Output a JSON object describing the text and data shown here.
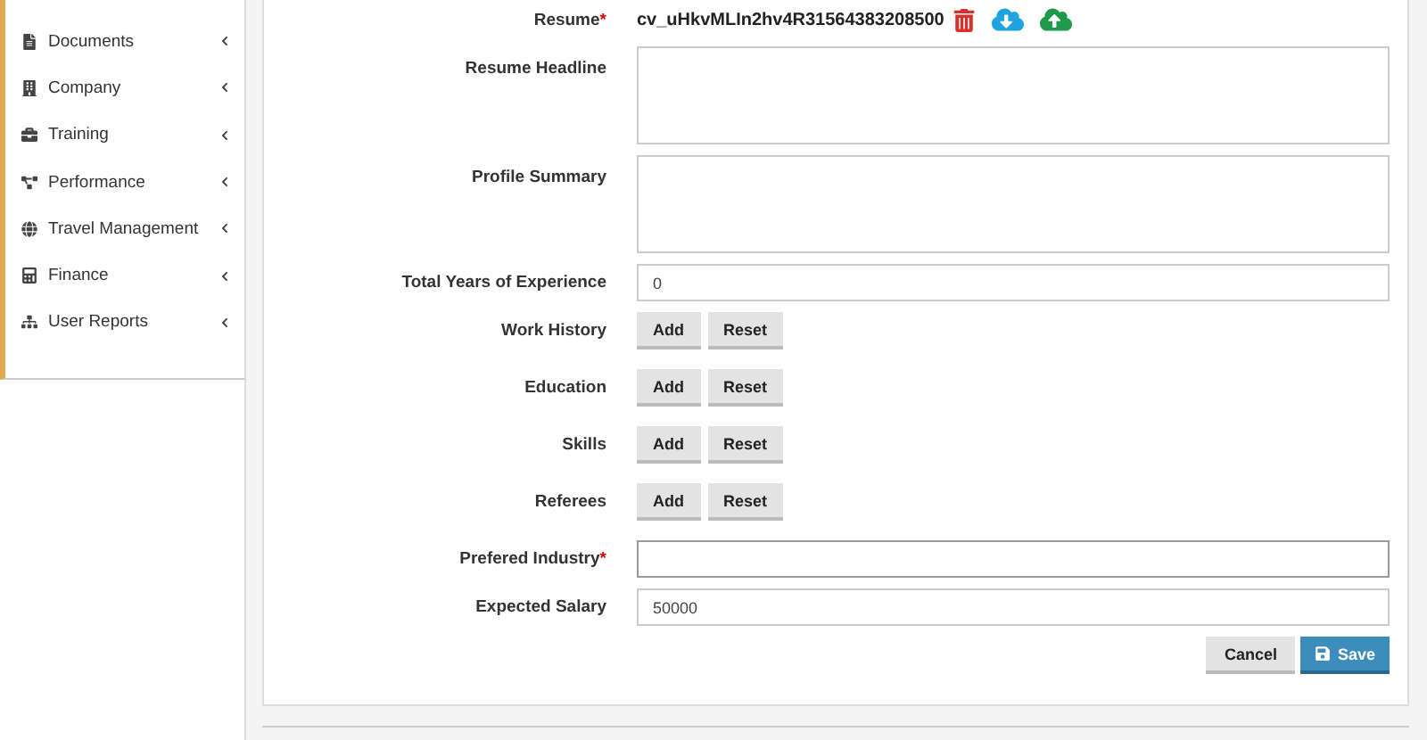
{
  "sidebar": {
    "items": [
      {
        "label": "Documents"
      },
      {
        "label": "Company"
      },
      {
        "label": "Training"
      },
      {
        "label": "Performance"
      },
      {
        "label": "Travel Management"
      },
      {
        "label": "Finance"
      },
      {
        "label": "User Reports"
      }
    ]
  },
  "form": {
    "fields": [
      {
        "kind": "file",
        "label": "Resume",
        "required_mark": "*",
        "value": "cv_uHkvMLIn2hv4R31564383208500"
      },
      {
        "kind": "textarea",
        "label": "Resume Headline"
      },
      {
        "kind": "textarea",
        "label": "Profile Summary"
      },
      {
        "kind": "text",
        "label": "Total Years of Experience",
        "value": "0"
      },
      {
        "kind": "buttons",
        "label": "Work History",
        "buttons": [
          "Add",
          "Reset"
        ]
      },
      {
        "kind": "buttons",
        "label": "Education",
        "buttons": [
          "Add",
          "Reset"
        ]
      },
      {
        "kind": "buttons",
        "label": "Skills",
        "buttons": [
          "Add",
          "Reset"
        ]
      },
      {
        "kind": "buttons",
        "label": "Referees",
        "buttons": [
          "Add",
          "Reset"
        ]
      },
      {
        "kind": "text",
        "label": "Prefered Industry",
        "required_mark": "*",
        "focused": true
      },
      {
        "kind": "text",
        "label": "Expected Salary",
        "value": "50000"
      }
    ],
    "actions": {
      "cancel": "Cancel",
      "save": "Save"
    }
  }
}
